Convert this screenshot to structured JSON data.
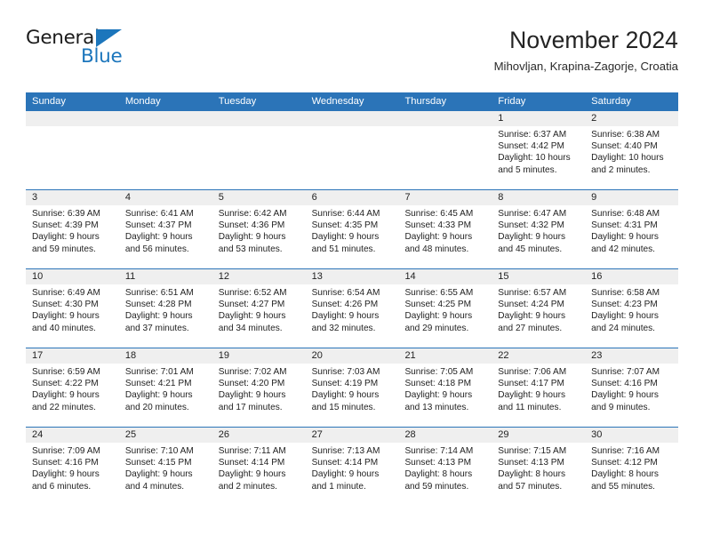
{
  "brand": {
    "logo_text_top": "General",
    "logo_text_bottom": "Blue",
    "logo_accent_color": "#1c76bc"
  },
  "header": {
    "title": "November 2024",
    "subtitle": "Mihovljan, Krapina-Zagorje, Croatia"
  },
  "theme": {
    "header_blue": "#2b74b8",
    "day_band_gray": "#efefef",
    "text_color": "#1f1f1f"
  },
  "calendar": {
    "weekdays": [
      "Sunday",
      "Monday",
      "Tuesday",
      "Wednesday",
      "Thursday",
      "Friday",
      "Saturday"
    ],
    "weeks": [
      [
        {
          "day": "",
          "lines": []
        },
        {
          "day": "",
          "lines": []
        },
        {
          "day": "",
          "lines": []
        },
        {
          "day": "",
          "lines": []
        },
        {
          "day": "",
          "lines": []
        },
        {
          "day": "1",
          "lines": [
            "Sunrise: 6:37 AM",
            "Sunset: 4:42 PM",
            "Daylight: 10 hours",
            "and 5 minutes."
          ]
        },
        {
          "day": "2",
          "lines": [
            "Sunrise: 6:38 AM",
            "Sunset: 4:40 PM",
            "Daylight: 10 hours",
            "and 2 minutes."
          ]
        }
      ],
      [
        {
          "day": "3",
          "lines": [
            "Sunrise: 6:39 AM",
            "Sunset: 4:39 PM",
            "Daylight: 9 hours",
            "and 59 minutes."
          ]
        },
        {
          "day": "4",
          "lines": [
            "Sunrise: 6:41 AM",
            "Sunset: 4:37 PM",
            "Daylight: 9 hours",
            "and 56 minutes."
          ]
        },
        {
          "day": "5",
          "lines": [
            "Sunrise: 6:42 AM",
            "Sunset: 4:36 PM",
            "Daylight: 9 hours",
            "and 53 minutes."
          ]
        },
        {
          "day": "6",
          "lines": [
            "Sunrise: 6:44 AM",
            "Sunset: 4:35 PM",
            "Daylight: 9 hours",
            "and 51 minutes."
          ]
        },
        {
          "day": "7",
          "lines": [
            "Sunrise: 6:45 AM",
            "Sunset: 4:33 PM",
            "Daylight: 9 hours",
            "and 48 minutes."
          ]
        },
        {
          "day": "8",
          "lines": [
            "Sunrise: 6:47 AM",
            "Sunset: 4:32 PM",
            "Daylight: 9 hours",
            "and 45 minutes."
          ]
        },
        {
          "day": "9",
          "lines": [
            "Sunrise: 6:48 AM",
            "Sunset: 4:31 PM",
            "Daylight: 9 hours",
            "and 42 minutes."
          ]
        }
      ],
      [
        {
          "day": "10",
          "lines": [
            "Sunrise: 6:49 AM",
            "Sunset: 4:30 PM",
            "Daylight: 9 hours",
            "and 40 minutes."
          ]
        },
        {
          "day": "11",
          "lines": [
            "Sunrise: 6:51 AM",
            "Sunset: 4:28 PM",
            "Daylight: 9 hours",
            "and 37 minutes."
          ]
        },
        {
          "day": "12",
          "lines": [
            "Sunrise: 6:52 AM",
            "Sunset: 4:27 PM",
            "Daylight: 9 hours",
            "and 34 minutes."
          ]
        },
        {
          "day": "13",
          "lines": [
            "Sunrise: 6:54 AM",
            "Sunset: 4:26 PM",
            "Daylight: 9 hours",
            "and 32 minutes."
          ]
        },
        {
          "day": "14",
          "lines": [
            "Sunrise: 6:55 AM",
            "Sunset: 4:25 PM",
            "Daylight: 9 hours",
            "and 29 minutes."
          ]
        },
        {
          "day": "15",
          "lines": [
            "Sunrise: 6:57 AM",
            "Sunset: 4:24 PM",
            "Daylight: 9 hours",
            "and 27 minutes."
          ]
        },
        {
          "day": "16",
          "lines": [
            "Sunrise: 6:58 AM",
            "Sunset: 4:23 PM",
            "Daylight: 9 hours",
            "and 24 minutes."
          ]
        }
      ],
      [
        {
          "day": "17",
          "lines": [
            "Sunrise: 6:59 AM",
            "Sunset: 4:22 PM",
            "Daylight: 9 hours",
            "and 22 minutes."
          ]
        },
        {
          "day": "18",
          "lines": [
            "Sunrise: 7:01 AM",
            "Sunset: 4:21 PM",
            "Daylight: 9 hours",
            "and 20 minutes."
          ]
        },
        {
          "day": "19",
          "lines": [
            "Sunrise: 7:02 AM",
            "Sunset: 4:20 PM",
            "Daylight: 9 hours",
            "and 17 minutes."
          ]
        },
        {
          "day": "20",
          "lines": [
            "Sunrise: 7:03 AM",
            "Sunset: 4:19 PM",
            "Daylight: 9 hours",
            "and 15 minutes."
          ]
        },
        {
          "day": "21",
          "lines": [
            "Sunrise: 7:05 AM",
            "Sunset: 4:18 PM",
            "Daylight: 9 hours",
            "and 13 minutes."
          ]
        },
        {
          "day": "22",
          "lines": [
            "Sunrise: 7:06 AM",
            "Sunset: 4:17 PM",
            "Daylight: 9 hours",
            "and 11 minutes."
          ]
        },
        {
          "day": "23",
          "lines": [
            "Sunrise: 7:07 AM",
            "Sunset: 4:16 PM",
            "Daylight: 9 hours",
            "and 9 minutes."
          ]
        }
      ],
      [
        {
          "day": "24",
          "lines": [
            "Sunrise: 7:09 AM",
            "Sunset: 4:16 PM",
            "Daylight: 9 hours",
            "and 6 minutes."
          ]
        },
        {
          "day": "25",
          "lines": [
            "Sunrise: 7:10 AM",
            "Sunset: 4:15 PM",
            "Daylight: 9 hours",
            "and 4 minutes."
          ]
        },
        {
          "day": "26",
          "lines": [
            "Sunrise: 7:11 AM",
            "Sunset: 4:14 PM",
            "Daylight: 9 hours",
            "and 2 minutes."
          ]
        },
        {
          "day": "27",
          "lines": [
            "Sunrise: 7:13 AM",
            "Sunset: 4:14 PM",
            "Daylight: 9 hours",
            "and 1 minute."
          ]
        },
        {
          "day": "28",
          "lines": [
            "Sunrise: 7:14 AM",
            "Sunset: 4:13 PM",
            "Daylight: 8 hours",
            "and 59 minutes."
          ]
        },
        {
          "day": "29",
          "lines": [
            "Sunrise: 7:15 AM",
            "Sunset: 4:13 PM",
            "Daylight: 8 hours",
            "and 57 minutes."
          ]
        },
        {
          "day": "30",
          "lines": [
            "Sunrise: 7:16 AM",
            "Sunset: 4:12 PM",
            "Daylight: 8 hours",
            "and 55 minutes."
          ]
        }
      ]
    ]
  }
}
